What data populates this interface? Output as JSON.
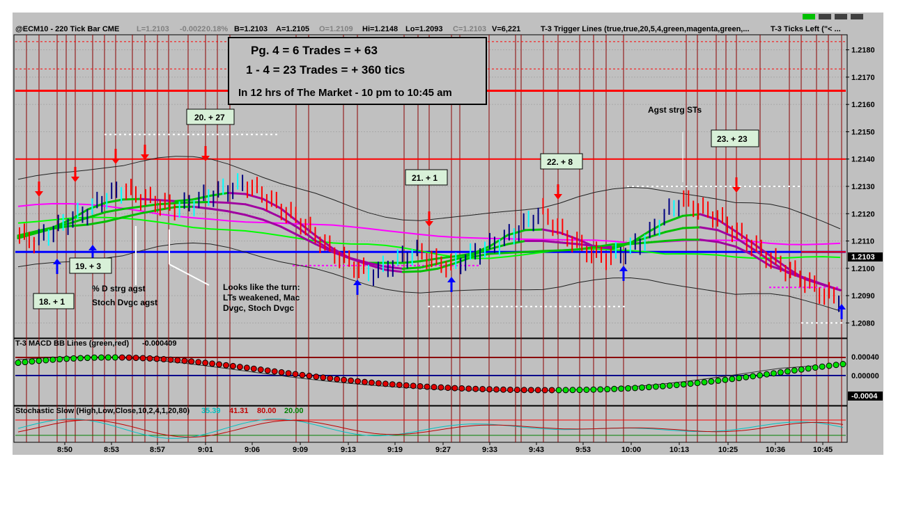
{
  "header": {
    "symbol_info": "@ECM10 - 220 Tick Bar  CME",
    "last": "L=1.2103",
    "change": "-0.0022",
    "change_pct": "0.18%",
    "bid": "B=1.2103",
    "ask": "A=1.2105",
    "open": "O=1.2109",
    "high": "Hi=1.2148",
    "low": "Lo=1.2093",
    "close": "C=1.2103",
    "volume": "V=6,221",
    "indicator1": "T-3 Trigger Lines (true,true,20,5,4,green,magenta,green,...",
    "indicator2": "T-3 Ticks Left (\"< ..."
  },
  "summary": {
    "line1": "Pg. 4 = 6 Trades = + 63",
    "line2": "1 - 4 = 23 Trades = + 360 tics",
    "line3": "In 12 hrs of The Market - 10 pm to 10:45 am"
  },
  "trades": [
    {
      "label": "18. + 1"
    },
    {
      "label": "19. + 3"
    },
    {
      "label": "20. + 27"
    },
    {
      "label": "21. + 1"
    },
    {
      "label": "22. + 8"
    },
    {
      "label": "23. + 23"
    }
  ],
  "annotations": {
    "note1_line1": "% D strg agst",
    "note1_line2": "Stoch Dvgc agst",
    "note2_line1": "Looks like the turn:",
    "note2_line2": "LTs weakened, Mac",
    "note2_line3": "Dvgc, Stoch Dvgc",
    "note3": "Agst strg STs"
  },
  "macd_panel": {
    "title": "T-3 MACD BB Lines (green,red)",
    "value": "-0.000409",
    "ticks": [
      "0.00040",
      "0.00000",
      "-0.0004"
    ]
  },
  "stoch_panel": {
    "title": "Stochastic Slow (High,Low,Close,10,2,4,1,20,80)",
    "v1": "35.39",
    "v2": "41.31",
    "v3": "80.00",
    "v4": "20.00"
  },
  "colors": {
    "background": "#c0c0c0",
    "up_bar": "#000080",
    "down_bar": "#ff0000",
    "trigger_green": "#00c000",
    "trigger_magenta": "#a000a0",
    "price_line": "#0000ff",
    "resistance": "#ff0000"
  },
  "chart_data": {
    "type": "line",
    "title": "@ECM10 - 220 Tick Bar CME",
    "xlabel": "",
    "ylabel": "",
    "current_price_label": "1.2103",
    "ylim": [
      1.2075,
      1.2185
    ],
    "y_ticks": [
      "1.2180",
      "1.2170",
      "1.2160",
      "1.2150",
      "1.2140",
      "1.2130",
      "1.2120",
      "1.2110",
      "1.2100",
      "1.2090",
      "1.2080"
    ],
    "x_ticks": [
      "8:50",
      "8:53",
      "8:57",
      "9:01",
      "9:06",
      "9:09",
      "9:13",
      "9:19",
      "9:27",
      "9:33",
      "9:43",
      "9:53",
      "10:00",
      "10:13",
      "10:25",
      "10:36",
      "10:45"
    ],
    "series": [
      {
        "name": "Price",
        "values": [
          1.2112,
          1.211,
          1.2114,
          1.2118,
          1.2121,
          1.2126,
          1.2129,
          1.2126,
          1.2124,
          1.2122,
          1.2124,
          1.2127,
          1.2129,
          1.2131,
          1.2127,
          1.2122,
          1.2118,
          1.2112,
          1.2106,
          1.2102,
          1.2098,
          1.21,
          1.2104,
          1.2106,
          1.2102,
          1.2101,
          1.2105,
          1.2108,
          1.2111,
          1.2116,
          1.2121,
          1.2114,
          1.2109,
          1.2105,
          1.2104,
          1.2107,
          1.2111,
          1.2119,
          1.2125,
          1.2122,
          1.2119,
          1.2114,
          1.2109,
          1.2104,
          1.21,
          1.2096,
          1.2091,
          1.2089
        ]
      }
    ],
    "levels": [
      1.2165,
      1.214,
      1.2106
    ]
  }
}
